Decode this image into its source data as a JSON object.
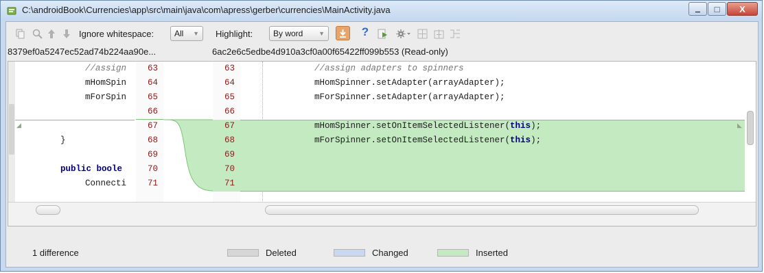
{
  "window": {
    "title": "C:\\androidBook\\Currencies\\app\\src\\main\\java\\com\\apress\\gerber\\currencies\\MainActivity.java",
    "close_glyph": "X",
    "minimize_glyph": "▁",
    "maximize_glyph": "□"
  },
  "toolbar": {
    "ignore_whitespace_label": "Ignore whitespace:",
    "ignore_whitespace_value": "All",
    "highlight_label": "Highlight:",
    "highlight_value": "By word",
    "icons": [
      "copy-icon",
      "find-icon",
      "previous-diff-icon",
      "next-diff-icon",
      "apply-icon",
      "help-icon",
      "export-icon",
      "settings-icon",
      "sync-left-icon",
      "sync-right-icon",
      "merge-icon"
    ]
  },
  "left_pane": {
    "revision": "8379ef0a5247ec52ad74b224aa90e...",
    "lines": [
      {
        "num": "63",
        "text": "//assign",
        "style": "comment"
      },
      {
        "num": "64",
        "text": "mHomSpin",
        "style": "code"
      },
      {
        "num": "65",
        "text": "mForSpin",
        "style": "code"
      },
      {
        "num": "66",
        "text": "",
        "style": "code"
      },
      {
        "num": "67",
        "text": "",
        "style": "code"
      },
      {
        "num": "68",
        "text": "}",
        "style": "code"
      },
      {
        "num": "69",
        "text": "",
        "style": "code"
      },
      {
        "num": "70",
        "text_kw": "public boole",
        "style": "keyword"
      },
      {
        "num": "71",
        "text": "Connecti",
        "style": "code"
      }
    ]
  },
  "right_pane": {
    "revision": "6ac2e6c5edbe4d910a3cf0a00f65422ff099b553 (Read-only)",
    "lines": [
      {
        "num": "63",
        "text": "//assign adapters to spinners",
        "style": "comment"
      },
      {
        "num": "64",
        "text": "mHomSpinner.setAdapter(arrayAdapter);",
        "style": "code"
      },
      {
        "num": "65",
        "text": "mForSpinner.setAdapter(arrayAdapter);",
        "style": "code"
      },
      {
        "num": "66",
        "text": "",
        "style": "code"
      },
      {
        "num": "67",
        "before": "mHomSpinner.setOnItemSelectedListener(",
        "kw": "this",
        "after": ");",
        "style": "inserted"
      },
      {
        "num": "68",
        "before": "mForSpinner.setOnItemSelectedListener(",
        "kw": "this",
        "after": ");",
        "style": "inserted"
      },
      {
        "num": "69",
        "text": "",
        "style": "inserted"
      },
      {
        "num": "70",
        "text": "",
        "style": "inserted"
      },
      {
        "num": "71",
        "text": "",
        "style": "code"
      }
    ]
  },
  "status": {
    "differences": "1 difference",
    "legend": [
      {
        "label": "Deleted",
        "color": "#d6d6d6"
      },
      {
        "label": "Changed",
        "color": "#c8d8f2"
      },
      {
        "label": "Inserted",
        "color": "#c3eac0"
      }
    ]
  },
  "colors": {
    "inserted": "#c3eac0",
    "line_number": "#8a1a1a",
    "keyword": "#000080"
  }
}
